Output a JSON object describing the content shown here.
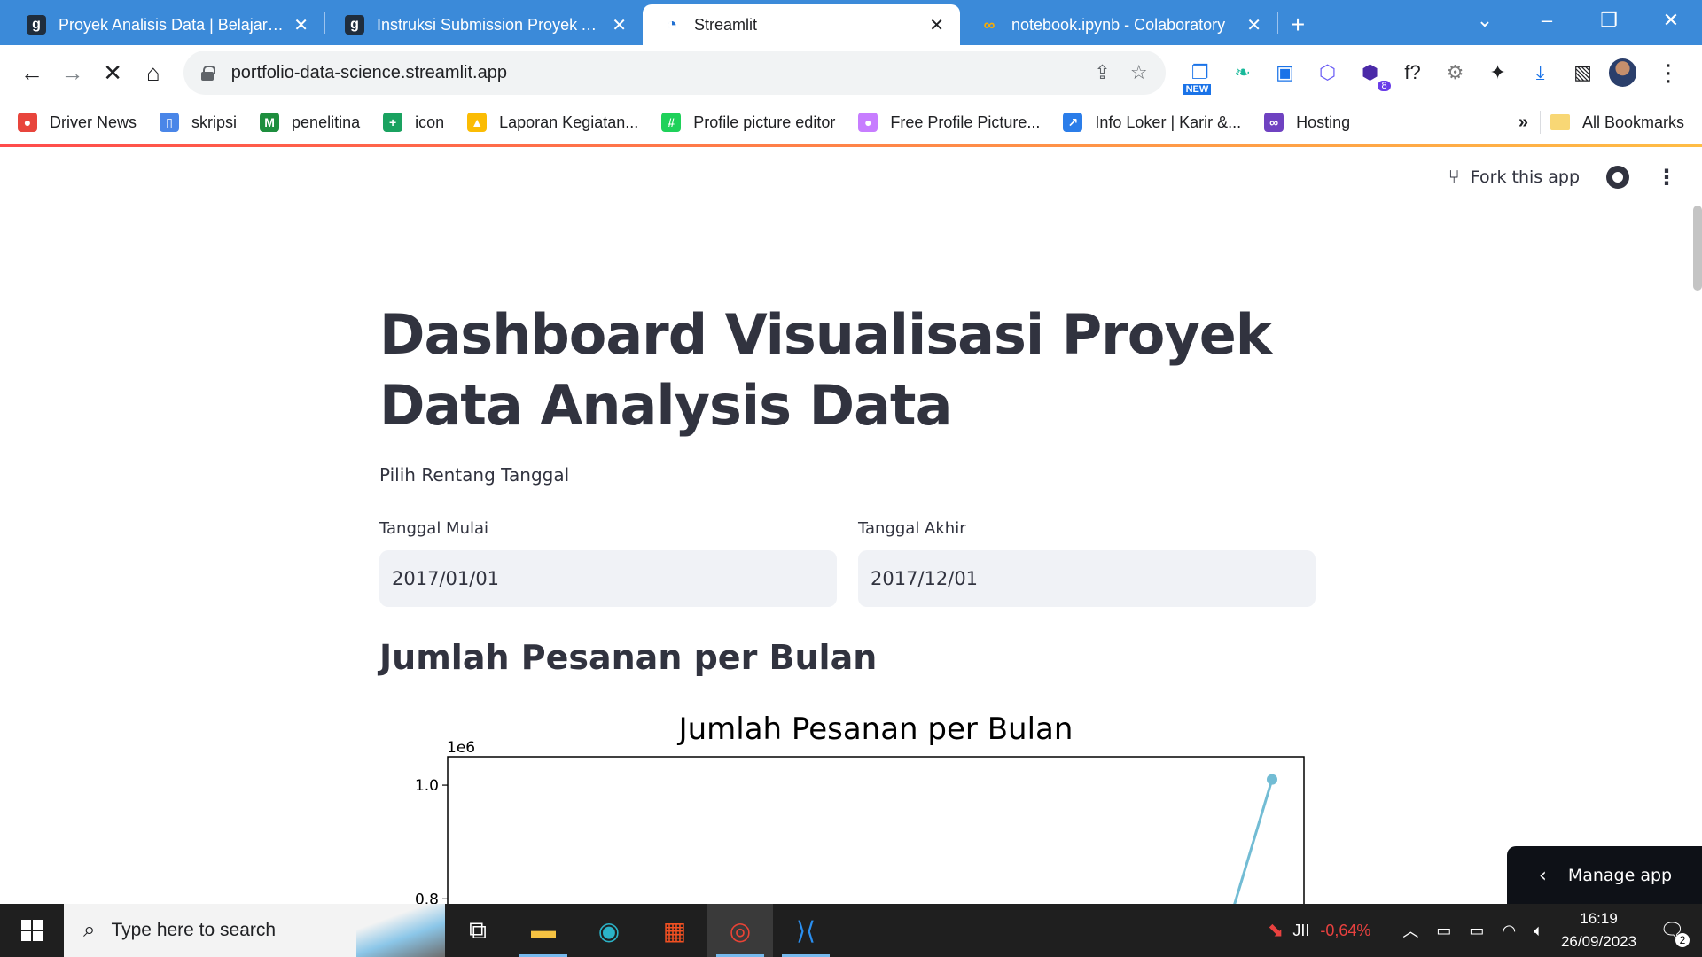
{
  "browser": {
    "tabs": [
      {
        "title": "Proyek Analisis Data | Belajar Ana",
        "favicon": "dicoding-icon",
        "fav_glyph": "g",
        "active": false
      },
      {
        "title": "Instruksi Submission Proyek Anal",
        "favicon": "dicoding-icon",
        "fav_glyph": "g",
        "active": false
      },
      {
        "title": "Streamlit",
        "favicon": "streamlit-icon",
        "fav_glyph": "◔",
        "active": true
      },
      {
        "title": "notebook.ipynb - Colaboratory",
        "favicon": "colab-icon",
        "fav_glyph": "∞",
        "active": false
      }
    ],
    "url": "portfolio-data-science.streamlit.app",
    "extensions": [
      {
        "name": "new-extension-icon",
        "glyph": "❐",
        "tag": "NEW"
      },
      {
        "name": "hummingbird-extension-icon",
        "glyph": "❧"
      },
      {
        "name": "bookmark-extension-icon",
        "glyph": "▣"
      },
      {
        "name": "hex-extension-icon",
        "glyph": "⬡"
      },
      {
        "name": "graduation-extension-icon",
        "glyph": "⬢",
        "badge": "8"
      },
      {
        "name": "function-extension-icon",
        "glyph": "f?"
      },
      {
        "name": "gear-extension-icon",
        "glyph": "⚙"
      },
      {
        "name": "puzzle-extensions-icon",
        "glyph": "✦"
      },
      {
        "name": "download-icon",
        "glyph": "⤓"
      },
      {
        "name": "side-panel-icon",
        "glyph": "▧"
      }
    ],
    "bookmarks": [
      {
        "label": "Driver News",
        "color": "#e8453c",
        "glyph": "●"
      },
      {
        "label": "skripsi",
        "color": "#4a86e8",
        "glyph": "▯"
      },
      {
        "label": "penelitina",
        "color": "#1e8e3e",
        "glyph": "M"
      },
      {
        "label": "icon",
        "color": "#1aa260",
        "glyph": "+"
      },
      {
        "label": "Laporan Kegiatan...",
        "color": "#fbbc04",
        "glyph": "▲"
      },
      {
        "label": "Profile picture editor",
        "color": "#1fd15a",
        "glyph": "#"
      },
      {
        "label": "Free Profile Picture...",
        "color": "#c77dff",
        "glyph": "●"
      },
      {
        "label": "Info Loker | Karir &...",
        "color": "#2b7de9",
        "glyph": "↗"
      },
      {
        "label": "Hosting",
        "color": "#6f42c1",
        "glyph": "∞"
      }
    ],
    "bookmarks_more": "»",
    "all_bookmarks": "All Bookmarks"
  },
  "streamlit": {
    "fork_label": "Fork this app",
    "title": "Dashboard Visualisasi Proyek Data Analysis Data",
    "range_label": "Pilih Rentang Tanggal",
    "start_label": "Tanggal Mulai",
    "start_value": "2017/01/01",
    "end_label": "Tanggal Akhir",
    "end_value": "2017/12/01",
    "section_title": "Jumlah Pesanan per Bulan",
    "manage_app": "Manage app"
  },
  "chart_data": {
    "type": "line",
    "title": "Jumlah Pesanan per Bulan",
    "scale_label": "1e6",
    "yticks": [
      "1.0",
      "0.8"
    ],
    "ylim": [
      0.76,
      1.05
    ],
    "visible_points": [
      {
        "x": 11.3,
        "y": 0.75
      },
      {
        "x": 12,
        "y": 1.01
      }
    ],
    "line_color": "#72bcd4"
  },
  "taskbar": {
    "search_placeholder": "Type here to search",
    "stock_name": "JII",
    "stock_change": "-0,64%",
    "time": "16:19",
    "date": "26/09/2023",
    "notifications": "2"
  }
}
